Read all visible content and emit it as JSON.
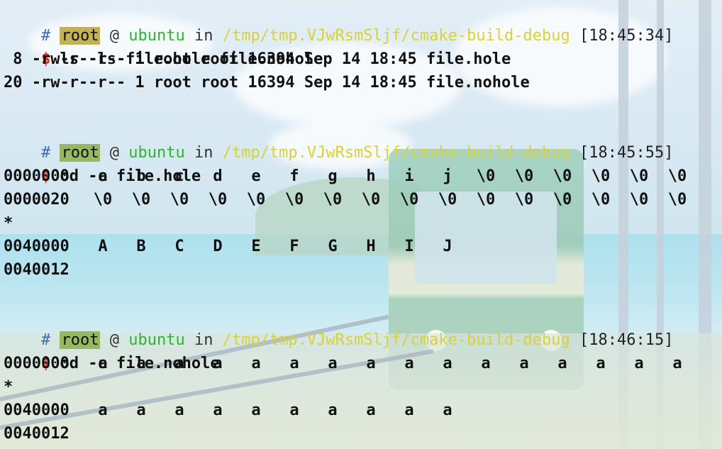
{
  "prompts": [
    {
      "hash": "#",
      "user": "root",
      "at": "@",
      "host": "ubuntu",
      "in": "in",
      "path": "/tmp/tmp.VJwRsmSljf/cmake-build-debug",
      "time": "[18:45:34]",
      "dollar": "$",
      "command": "ls -ls file.hole file.nohole"
    },
    {
      "hash": "#",
      "user": "root",
      "at": "@",
      "host": "ubuntu",
      "in": "in",
      "path": "/tmp/tmp.VJwRsmSljf/cmake-build-debug",
      "time": "[18:45:55]",
      "dollar": "$",
      "command": "od -c file.hole"
    },
    {
      "hash": "#",
      "user": "root",
      "at": "@",
      "host": "ubuntu",
      "in": "in",
      "path": "/tmp/tmp.VJwRsmSljf/cmake-build-debug",
      "time": "[18:46:15]",
      "dollar": "$",
      "command": "od -c file.nohole"
    }
  ],
  "ls_output": [
    " 8 -rw-r--r-- 1 root root 16394 Sep 14 18:45 file.hole",
    "20 -rw-r--r-- 1 root root 16394 Sep 14 18:45 file.nohole"
  ],
  "od_hole": [
    {
      "offset": "0000000",
      "cells": [
        "a",
        "b",
        "c",
        "d",
        "e",
        "f",
        "g",
        "h",
        "i",
        "j",
        "\\0",
        "\\0",
        "\\0",
        "\\0",
        "\\0",
        "\\0"
      ]
    },
    {
      "offset": "0000020",
      "cells": [
        "\\0",
        "\\0",
        "\\0",
        "\\0",
        "\\0",
        "\\0",
        "\\0",
        "\\0",
        "\\0",
        "\\0",
        "\\0",
        "\\0",
        "\\0",
        "\\0",
        "\\0",
        "\\0"
      ]
    },
    {
      "offset": "*",
      "cells": []
    },
    {
      "offset": "0040000",
      "cells": [
        "A",
        "B",
        "C",
        "D",
        "E",
        "F",
        "G",
        "H",
        "I",
        "J"
      ]
    },
    {
      "offset": "0040012",
      "cells": []
    }
  ],
  "od_nohole": [
    {
      "offset": "0000000",
      "cells": [
        "a",
        "a",
        "a",
        "a",
        "a",
        "a",
        "a",
        "a",
        "a",
        "a",
        "a",
        "a",
        "a",
        "a",
        "a",
        "a"
      ]
    },
    {
      "offset": "*",
      "cells": []
    },
    {
      "offset": "0040000",
      "cells": [
        "a",
        "a",
        "a",
        "a",
        "a",
        "a",
        "a",
        "a",
        "a",
        "a"
      ]
    },
    {
      "offset": "0040012",
      "cells": []
    }
  ],
  "colors": {
    "hash": "#3d6db0",
    "user_bg": "#c3b155",
    "user_bg_alt": "#97b861",
    "host": "#2bb62f",
    "path": "#d8d238",
    "dollar": "#d12b1c",
    "text": "#111111"
  },
  "wallpaper": "seaside-train-scene"
}
